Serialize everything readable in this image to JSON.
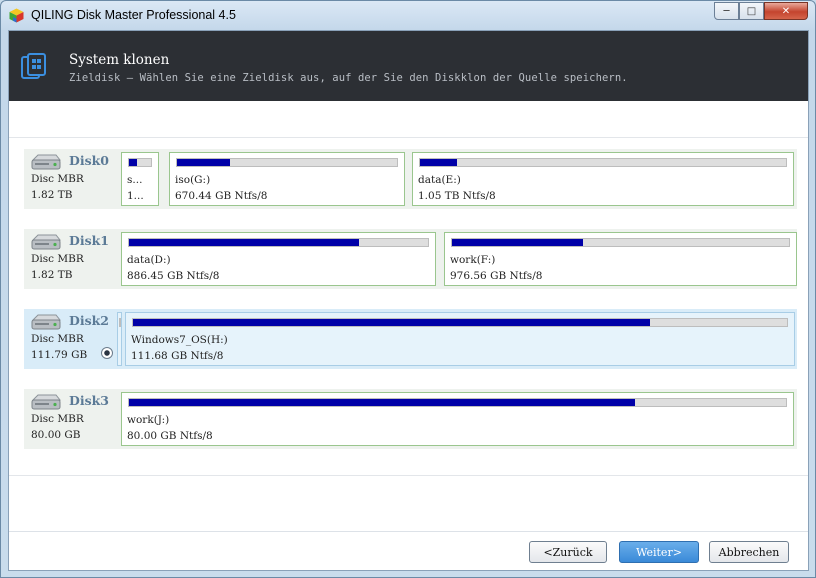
{
  "window": {
    "title": "QILING Disk Master Professional 4.5",
    "buttons": {
      "minimize": "─",
      "maximize": "□",
      "close": "✕"
    }
  },
  "header": {
    "title": "System klonen",
    "subtitle": "Zieldisk – Wählen Sie eine Zieldisk aus, auf der Sie den Diskklon der Quelle speichern.",
    "icon": "clone-disk-icon"
  },
  "disks": [
    {
      "name": "Disk0",
      "type": "Disc MBR",
      "size": "1.82 TB",
      "selected": false,
      "partitions": [
        {
          "label": "s...",
          "info": "1...",
          "used": 0.35
        },
        {
          "label": "iso(G:)",
          "info": "670.44 GB Ntfs/8",
          "used": 0.24
        },
        {
          "label": "data(E:)",
          "info": "1.05 TB Ntfs/8",
          "used": 0.1
        }
      ]
    },
    {
      "name": "Disk1",
      "type": "Disc MBR",
      "size": "1.82 TB",
      "selected": false,
      "partitions": [
        {
          "label": "data(D:)",
          "info": "886.45 GB Ntfs/8",
          "used": 0.77
        },
        {
          "label": "work(F:)",
          "info": "976.56 GB Ntfs/8",
          "used": 0.39
        }
      ]
    },
    {
      "name": "Disk2",
      "type": "Disc MBR",
      "size": "111.79 GB",
      "selected": true,
      "partitions": [
        {
          "label": "",
          "info": "",
          "used": 1.0
        },
        {
          "label": "Windows7_OS(H:)",
          "info": "111.68 GB Ntfs/8",
          "used": 0.79
        }
      ]
    },
    {
      "name": "Disk3",
      "type": "Disc MBR",
      "size": "80.00 GB",
      "selected": false,
      "partitions": [
        {
          "label": "work(J:)",
          "info": "80.00 GB Ntfs/8",
          "used": 0.77
        }
      ]
    }
  ],
  "footer": {
    "back": "<Zurück",
    "next": "Weiter>",
    "cancel": "Abbrechen"
  },
  "colors": {
    "header_bg": "#2c2f34",
    "bar_fill": "#0000a8",
    "primary_button": "#3a8ad8"
  }
}
